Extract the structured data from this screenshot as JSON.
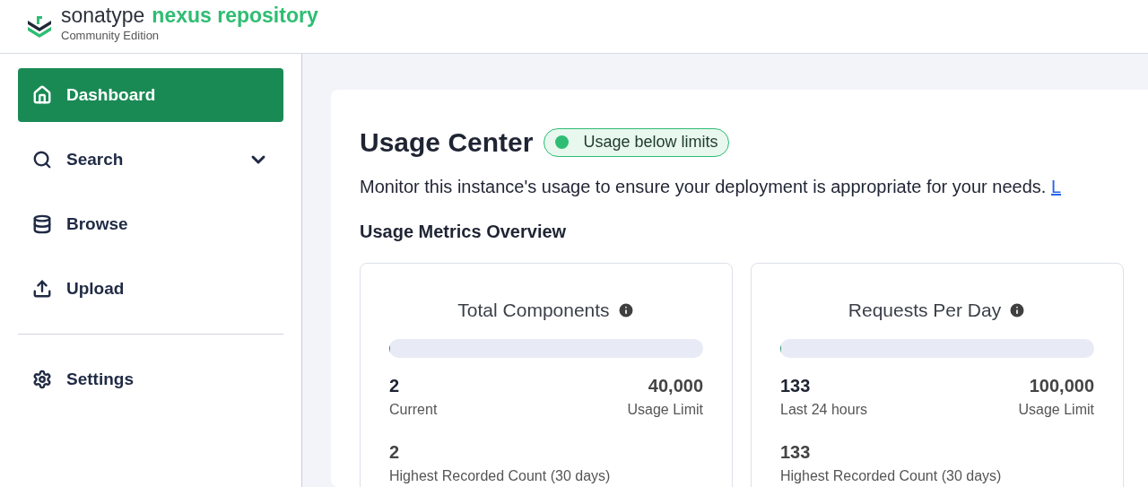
{
  "header": {
    "brand": "sonatype",
    "product": "nexus repository",
    "edition": "Community Edition"
  },
  "sidebar": {
    "items": [
      {
        "kind": "link",
        "label": "Dashboard",
        "selected": true
      },
      {
        "kind": "group",
        "label": "Search",
        "selected": false,
        "expanded": false
      },
      {
        "kind": "link",
        "label": "Browse",
        "selected": false
      },
      {
        "kind": "link",
        "label": "Upload",
        "selected": false
      },
      {
        "kind": "divider"
      },
      {
        "kind": "link",
        "label": "Settings",
        "selected": false
      }
    ]
  },
  "main": {
    "title": "Usage Center",
    "status": {
      "label": "Usage below limits",
      "color": "#2ebd72"
    },
    "description": "Monitor this instance's usage to ensure your deployment is appropriate for your needs.",
    "link": "L",
    "section_title": "Usage Metrics Overview",
    "metrics": [
      {
        "title": "Total Components",
        "level": 5e-05,
        "current": "2",
        "current_label": "Current",
        "limit": "40,000",
        "limit_label": "Usage Limit",
        "highest": "2",
        "highest_label": "Highest Recorded Count (30 days)"
      },
      {
        "title": "Requests Per Day",
        "level": 0.00133,
        "current": "133",
        "current_label": "Last 24 hours",
        "limit": "100,000",
        "limit_label": "Usage Limit",
        "highest": "133",
        "highest_label": "Highest Recorded Count (30 days)"
      }
    ]
  }
}
